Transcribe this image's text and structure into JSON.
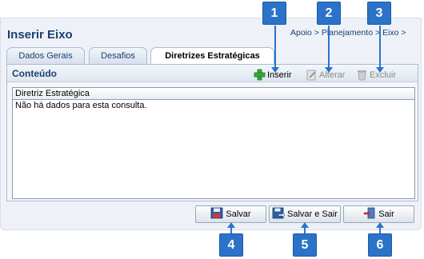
{
  "page": {
    "title": "Inserir Eixo",
    "breadcrumb": "Apoio > Planejamento > Eixo >"
  },
  "tabs": [
    {
      "label": "Dados Gerais",
      "active": false
    },
    {
      "label": "Desafios",
      "active": false
    },
    {
      "label": "Diretrizes Estratégicas",
      "active": true
    }
  ],
  "panel": {
    "title": "Conteúdo"
  },
  "toolbar": {
    "insert": {
      "label": "Inserir",
      "icon": "plus-icon"
    },
    "edit": {
      "label": "Alterar",
      "icon": "edit-icon",
      "disabled": true
    },
    "delete": {
      "label": "Excluir",
      "icon": "trash-icon",
      "disabled": true
    }
  },
  "grid": {
    "columns": [
      "Diretriz Estratégica"
    ],
    "empty_message": "Não há dados para esta consulta."
  },
  "buttons": {
    "save": {
      "label": "Salvar",
      "icon": "floppy-icon"
    },
    "save_exit": {
      "label": "Salvar e Sair",
      "icon": "floppy-exit-icon"
    },
    "exit": {
      "label": "Sair",
      "icon": "exit-door-icon"
    }
  },
  "callouts": [
    "1",
    "2",
    "3",
    "4",
    "5",
    "6"
  ],
  "colors": {
    "callout": "#2a73c9",
    "title": "#1c3f6e"
  }
}
